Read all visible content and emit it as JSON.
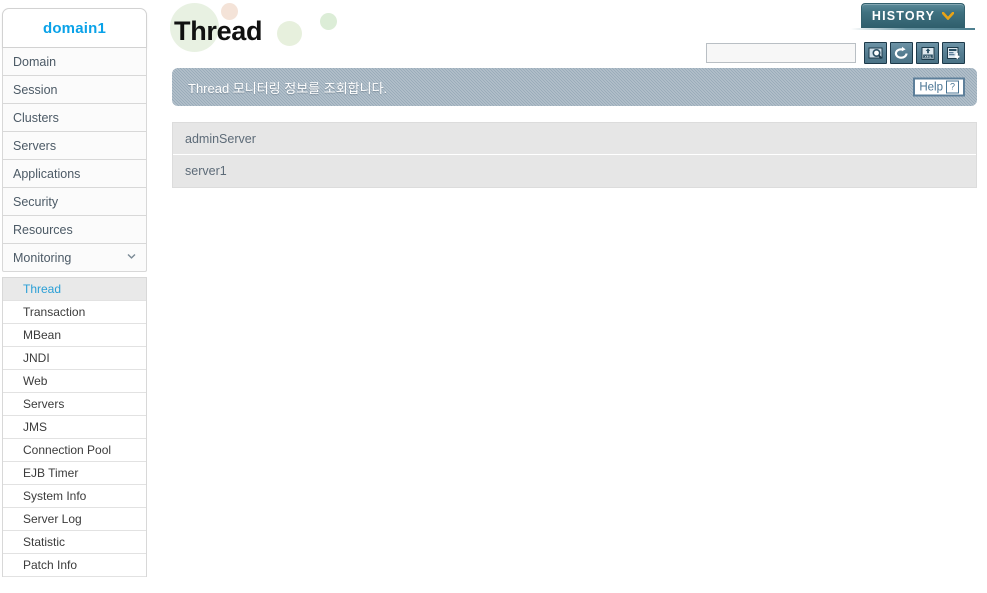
{
  "sidebar": {
    "domain_label": "domain1",
    "nav_items": [
      {
        "label": "Domain",
        "expandable": false,
        "expanded": false
      },
      {
        "label": "Session",
        "expandable": false,
        "expanded": false
      },
      {
        "label": "Clusters",
        "expandable": false,
        "expanded": false
      },
      {
        "label": "Servers",
        "expandable": false,
        "expanded": false
      },
      {
        "label": "Applications",
        "expandable": false,
        "expanded": false
      },
      {
        "label": "Security",
        "expandable": false,
        "expanded": false
      },
      {
        "label": "Resources",
        "expandable": false,
        "expanded": false
      },
      {
        "label": "Monitoring",
        "expandable": true,
        "expanded": true
      }
    ],
    "submenu_items": [
      {
        "label": "Thread",
        "active": true
      },
      {
        "label": "Transaction",
        "active": false
      },
      {
        "label": "MBean",
        "active": false
      },
      {
        "label": "JNDI",
        "active": false
      },
      {
        "label": "Web",
        "active": false
      },
      {
        "label": "Servers",
        "active": false
      },
      {
        "label": "JMS",
        "active": false
      },
      {
        "label": "Connection Pool",
        "active": false
      },
      {
        "label": "EJB Timer",
        "active": false
      },
      {
        "label": "System Info",
        "active": false
      },
      {
        "label": "Server Log",
        "active": false
      },
      {
        "label": "Statistic",
        "active": false
      },
      {
        "label": "Patch Info",
        "active": false
      }
    ]
  },
  "header": {
    "page_title": "Thread",
    "history_label": "HISTORY"
  },
  "toolbar": {
    "search_value": "",
    "search_placeholder": "",
    "buttons": [
      {
        "icon": "search-icon",
        "title": "Search"
      },
      {
        "icon": "refresh-icon",
        "title": "Refresh"
      },
      {
        "icon": "xml-export-icon",
        "title": "Export XML"
      },
      {
        "icon": "report-export-icon",
        "title": "Export Report"
      }
    ]
  },
  "info_bar": {
    "message": "Thread 모니터링 정보를 조회합니다.",
    "help_label": "Help",
    "help_mark": "?"
  },
  "servers": [
    {
      "name": "adminServer"
    },
    {
      "name": "server1"
    }
  ],
  "colors": {
    "accent_blue": "#0aa2e8",
    "active_item": "#2a9fd6",
    "info_bar": "#9aacba",
    "history_btn": "#3f7180",
    "chevron_gold": "#e8a317",
    "row_bg": "#e6e6e6",
    "tool_btn": "#567e92"
  }
}
